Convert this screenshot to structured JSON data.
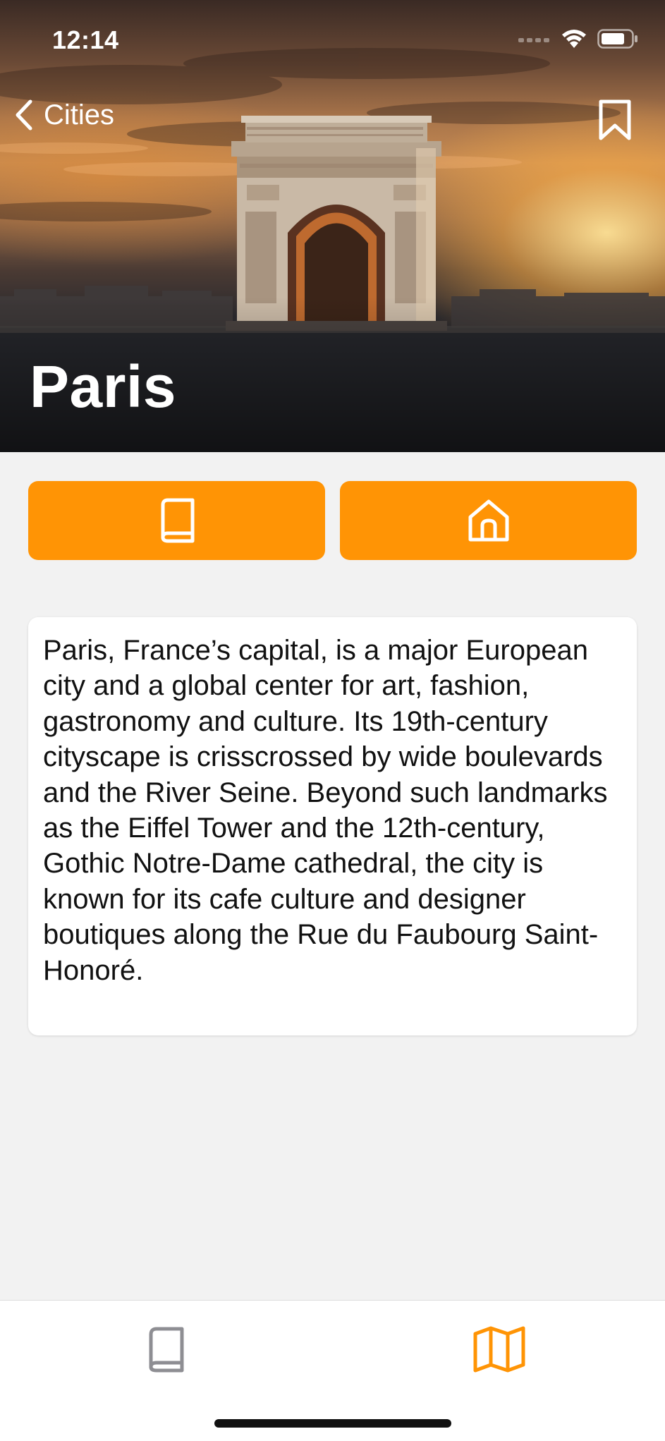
{
  "status_bar": {
    "time": "12:14"
  },
  "nav": {
    "back_label": "Cities"
  },
  "city": {
    "name": "Paris",
    "description": "Paris, France’s capital, is a major European city and a global center for art, fashion, gastronomy and culture. Its 19th-century cityscape is crisscrossed by wide boulevards and the River Seine. Beyond such landmarks as the Eiffel Tower and the 12th-century, Gothic Notre-Dame cathedral, the city is known for its cafe culture and designer boutiques along the Rue du Faubourg Saint-Honoré."
  },
  "actions": [
    {
      "icon": "book-icon"
    },
    {
      "icon": "home-icon"
    }
  ],
  "tabs": [
    {
      "icon": "book-icon",
      "selected": false
    },
    {
      "icon": "map-icon",
      "selected": true
    }
  ],
  "colors": {
    "accent": "#ff9405",
    "background": "#f2f2f2",
    "tab_inactive": "#8e8e93",
    "card": "#ffffff"
  }
}
